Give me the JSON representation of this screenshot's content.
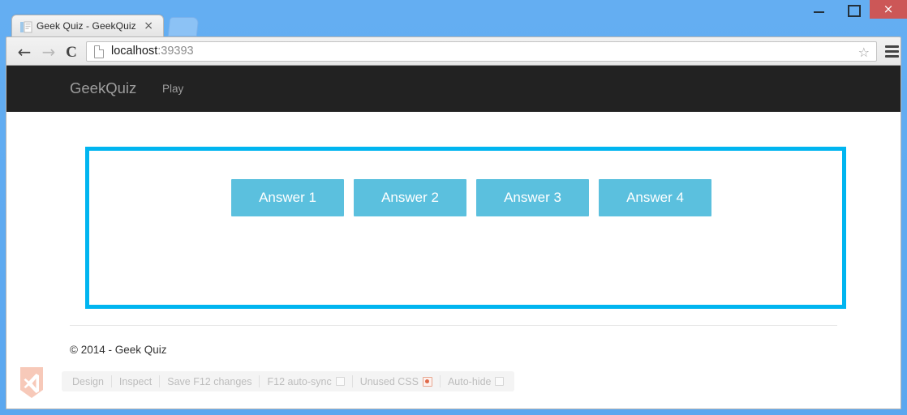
{
  "window": {
    "minimize_label": "minimize",
    "maximize_label": "maximize",
    "close_label": "×"
  },
  "browser": {
    "tab": {
      "title": "Geek Quiz - GeekQuiz",
      "close_glyph": "×",
      "favicon_name": "page-favicon"
    },
    "new_tab_label": "",
    "back_glyph": "←",
    "forward_glyph": "→",
    "reload_glyph": "C",
    "star_glyph": "☆",
    "url": {
      "host": "localhost",
      "port": ":39393",
      "full": "localhost:39393"
    }
  },
  "site": {
    "brand": "GeekQuiz",
    "nav": [
      {
        "label": "Play"
      }
    ],
    "answers": [
      {
        "label": "Answer 1"
      },
      {
        "label": "Answer 2"
      },
      {
        "label": "Answer 3"
      },
      {
        "label": "Answer 4"
      }
    ],
    "copyright": "© 2014 - Geek Quiz"
  },
  "browser_link_toolbar": {
    "items": [
      {
        "label": "Design",
        "control": "none"
      },
      {
        "label": "Inspect",
        "control": "none"
      },
      {
        "label": "Save F12 changes",
        "control": "none"
      },
      {
        "label": "F12 auto-sync",
        "control": "checkbox"
      },
      {
        "label": "Unused CSS",
        "control": "radio-dot"
      },
      {
        "label": "Auto-hide",
        "control": "checkbox"
      }
    ],
    "logo_name": "visual-studio-logo"
  },
  "colors": {
    "window_frame": "#5ba7f0",
    "close_button": "#cc5757",
    "navbar": "#222222",
    "highlight_border": "#00b5f0",
    "answer_button": "#5bc0de",
    "brand_text": "#9d9d9d"
  }
}
